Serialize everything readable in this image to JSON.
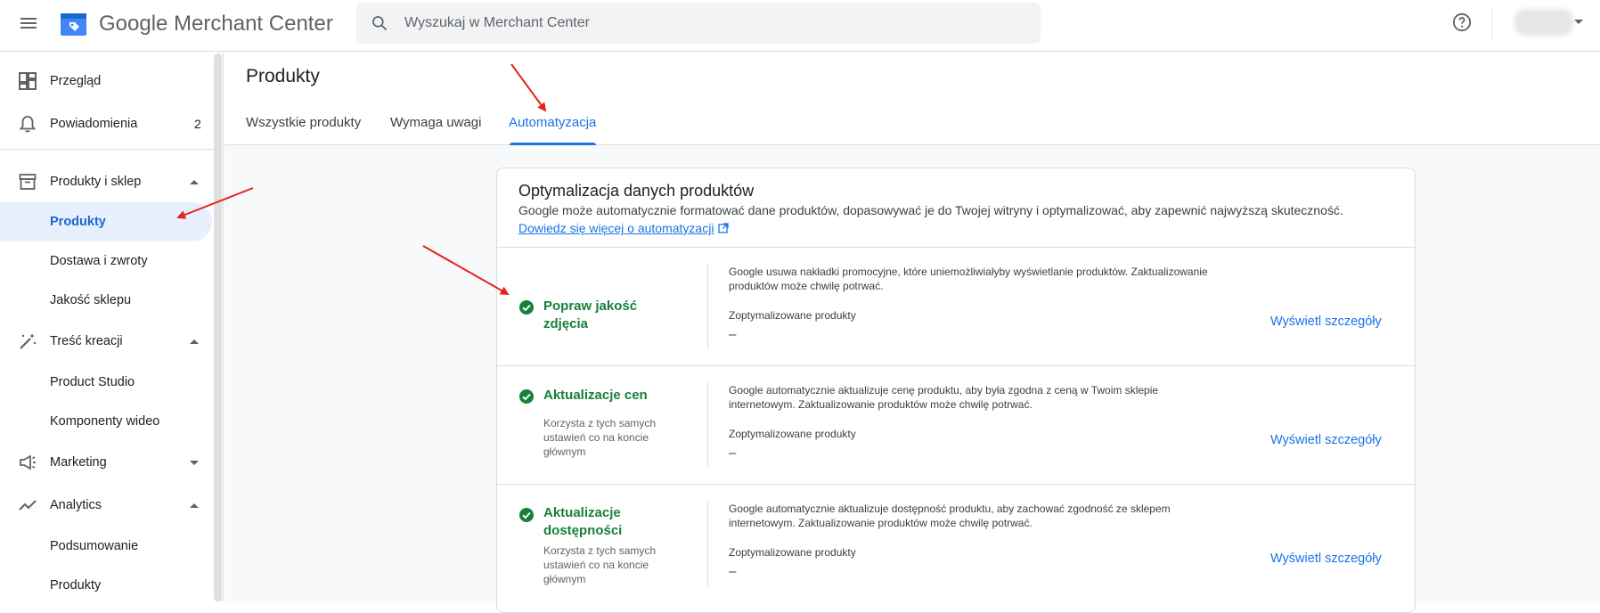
{
  "header": {
    "brand": "Google Merchant Center",
    "search_placeholder": "Wyszukaj w Merchant Center",
    "icons": [
      "menu-icon",
      "merchant-logo-icon",
      "search-icon",
      "help-icon"
    ]
  },
  "sidebar": {
    "items": [
      {
        "label": "Przegląd",
        "icon": "dashboard-icon"
      },
      {
        "label": "Powiadomienia",
        "icon": "bell-icon",
        "badge": "2"
      },
      {
        "label": "Produkty i sklep",
        "icon": "store-icon",
        "expanded": true
      },
      {
        "label": "Produkty",
        "active": true
      },
      {
        "label": "Dostawa i zwroty"
      },
      {
        "label": "Jakość sklepu"
      },
      {
        "label": "Treść kreacji",
        "icon": "magic-wand-icon",
        "expanded": true
      },
      {
        "label": "Product Studio"
      },
      {
        "label": "Komponenty wideo"
      },
      {
        "label": "Marketing",
        "icon": "megaphone-icon",
        "expanded": false
      },
      {
        "label": "Analytics",
        "icon": "trending-icon",
        "expanded": true
      },
      {
        "label": "Podsumowanie"
      },
      {
        "label": "Produkty"
      }
    ]
  },
  "page": {
    "title": "Produkty",
    "tabs": [
      {
        "label": "Wszystkie produkty"
      },
      {
        "label": "Wymaga uwagi"
      },
      {
        "label": "Automatyzacja",
        "active": true
      }
    ]
  },
  "card": {
    "title": "Optymalizacja danych produktów",
    "description": "Google może automatycznie formatować dane produktów, dopasowywać je do Twojej witryny i optymalizować, aby zapewnić najwyższą skuteczność.",
    "link": "Dowiedz się więcej o automatyzacji",
    "rows": [
      {
        "name": "Popraw jakość zdjęcia",
        "note": "",
        "description": "Google usuwa nakładki promocyjne, które uniemożliwiałyby wyświetlanie produktów. Zaktualizowanie produktów może chwilę potrwać.",
        "metric_label": "Zoptymalizowane produkty",
        "metric_value": "–",
        "action": "Wyświetl szczegóły"
      },
      {
        "name": "Aktualizacje cen",
        "note": "Korzysta z tych samych ustawień co na koncie głównym",
        "description": "Google automatycznie aktualizuje cenę produktu, aby była zgodna z ceną w Twoim sklepie internetowym. Zaktualizowanie produktów może chwilę potrwać.",
        "metric_label": "Zoptymalizowane produkty",
        "metric_value": "–",
        "action": "Wyświetl szczegóły"
      },
      {
        "name": "Aktualizacje dostępności",
        "note": "Korzysta z tych samych ustawień co na koncie głównym",
        "description": "Google automatycznie aktualizuje dostępność produktu, aby zachować zgodność ze sklepem internetowym. Zaktualizowanie produktów może chwilę potrwać.",
        "metric_label": "Zoptymalizowane produkty",
        "metric_value": "–",
        "action": "Wyświetl szczegóły"
      }
    ]
  },
  "colors": {
    "accent": "#1a73e8",
    "success": "#188038",
    "annotation": "#e8221c"
  }
}
